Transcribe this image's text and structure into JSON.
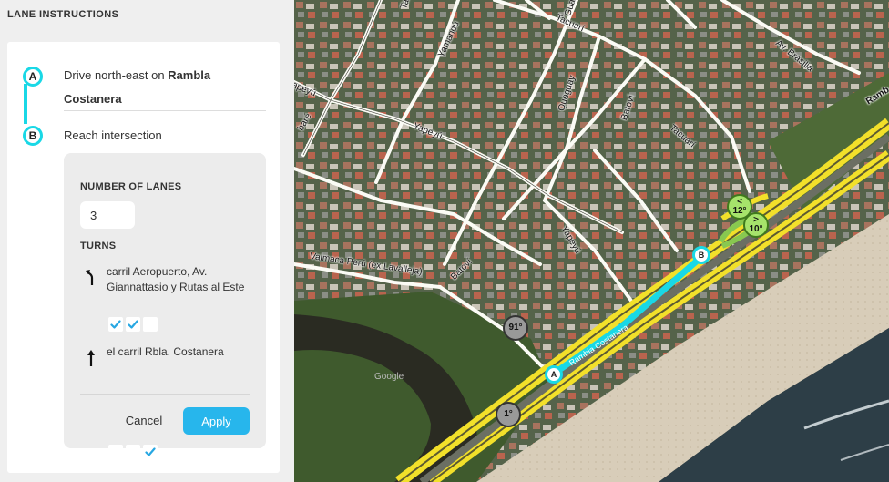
{
  "panel": {
    "title": "LANE INSTRUCTIONS",
    "steps": [
      {
        "marker": "A",
        "text_prefix": "Drive north-east on ",
        "text_bold": "Rambla Costanera"
      },
      {
        "marker": "B",
        "text": "Reach intersection"
      }
    ],
    "lanes": {
      "label": "NUMBER OF LANES",
      "value": "3",
      "turns_label": "TURNS",
      "turns": [
        {
          "icon": "bear-left-arrow-icon",
          "text": "carril Aeropuerto, Av. Giannattasio y Rutas al Este",
          "checks": [
            true,
            true,
            false
          ]
        },
        {
          "icon": "straight-arrow-icon",
          "text": "el carril Rbla. Costanera",
          "checks": [
            false,
            false,
            true
          ]
        }
      ]
    },
    "buttons": {
      "cancel": "Cancel",
      "apply": "Apply"
    }
  },
  "map": {
    "streets": {
      "tabare": "Tabaré",
      "yamandu": "Yamandú",
      "guarani": "Guaraní",
      "tacuari_top": "Tacuarí",
      "av_brasilia": "Av. Brasilia",
      "rambla": "Ramb",
      "yapeyu_left": "apeyú",
      "yapeyu_mid": "Yapeyú",
      "queguay": "Queguay",
      "batovi_top": "Batoví",
      "tacuari_right": "Tacuarí",
      "tabare_left": "baré",
      "yapeyu_bottom": "Yapeyú",
      "vaimaca": "Vaimaca Perú (ex Lavalleja)",
      "batovi_bottom": "Batoví",
      "rambla_costanera": "Rambla Costanera",
      "google": "Google"
    },
    "badges": [
      {
        "name": "angle-badge-91",
        "text": "91°",
        "style": "grey"
      },
      {
        "name": "angle-badge-1",
        "text": "1°",
        "style": "grey"
      },
      {
        "name": "angle-badge-12",
        "text": "<\n12°",
        "style": "green"
      },
      {
        "name": "angle-badge-10",
        "text": ">\n10°",
        "style": "green"
      }
    ],
    "markers": {
      "a": "A",
      "b": "B"
    },
    "colors": {
      "route": "#19d8e6",
      "highway": "#f2e02a",
      "badge_green": "#a6e36b"
    }
  }
}
